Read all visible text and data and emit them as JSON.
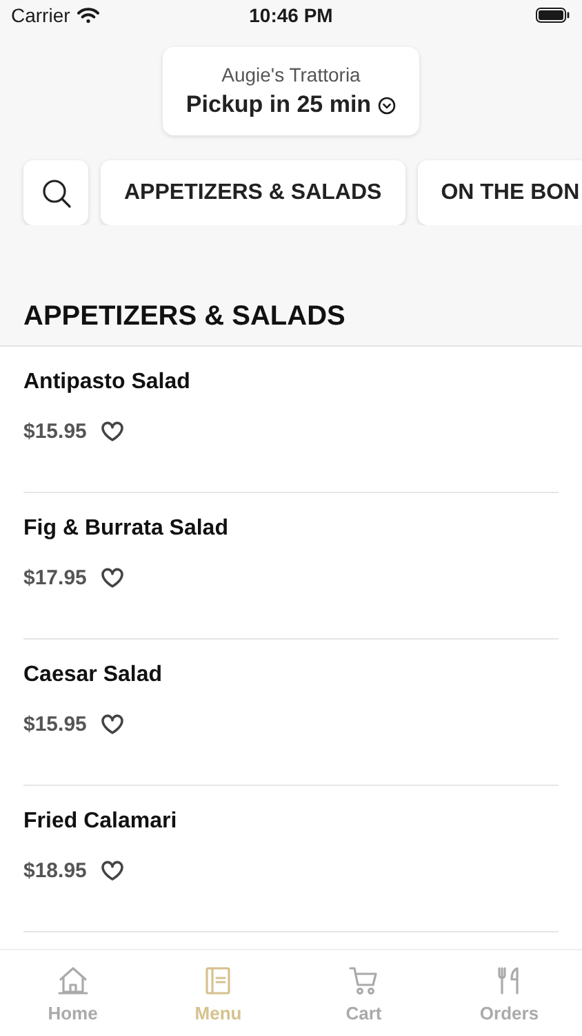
{
  "status_bar": {
    "carrier": "Carrier",
    "time": "10:46 PM"
  },
  "header": {
    "restaurant": "Augie's Trattoria",
    "pickup": "Pickup in 25 min"
  },
  "categories": [
    {
      "label": "APPETIZERS & SALADS"
    },
    {
      "label": "ON THE BON"
    }
  ],
  "section_title": "APPETIZERS & SALADS",
  "items": [
    {
      "name": "Antipasto Salad",
      "price": "$15.95"
    },
    {
      "name": "Fig & Burrata Salad",
      "price": "$17.95"
    },
    {
      "name": "Caesar Salad",
      "price": "$15.95"
    },
    {
      "name": "Fried Calamari",
      "price": "$18.95"
    }
  ],
  "tab_bar": [
    {
      "kind": "home",
      "label": "Home",
      "selected": false
    },
    {
      "kind": "menu",
      "label": "Menu",
      "selected": true
    },
    {
      "kind": "cart",
      "label": "Cart",
      "selected": false
    },
    {
      "kind": "orders",
      "label": "Orders",
      "selected": false
    }
  ]
}
